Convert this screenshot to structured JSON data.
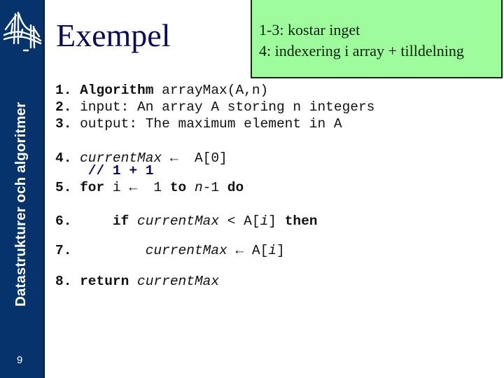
{
  "sidebar": {
    "vertical_title": "Datastrukturer och algoritmer",
    "logo_icon": "bridge-logo-icon",
    "page_number": "9"
  },
  "slide": {
    "title": "Exempel"
  },
  "note": {
    "line1": "1-3: kostar inget",
    "line2": "4: indexering i array + tilldelning"
  },
  "code": {
    "lines": [
      {
        "num": "1.",
        "parts": [
          "Algorithm",
          " arrayMax(A,n)"
        ]
      },
      {
        "num": "2.",
        "parts": [
          " input: An array A storing n integers"
        ]
      },
      {
        "num": "3.",
        "parts": [
          " output: The maximum element in A"
        ]
      },
      {
        "num": "4.",
        "parts": [
          " ",
          "currentMax",
          " ←  A[0]"
        ]
      },
      {
        "comment": "    // 1 + 1"
      },
      {
        "num": "5.",
        "parts": [
          " ",
          "for",
          " i ←  1 ",
          "to",
          " ",
          "n",
          "-1 ",
          "do"
        ]
      },
      {
        "num": "6.",
        "parts": [
          "     ",
          "if",
          " ",
          "currentMax",
          " < A[",
          "i",
          "] ",
          "then"
        ]
      },
      {
        "num": "7.",
        "parts": [
          "         ",
          "currentMax",
          " ← A[",
          "i",
          "]"
        ]
      },
      {
        "num": "8.",
        "parts": [
          " ",
          "return",
          " ",
          "currentMax"
        ]
      }
    ]
  },
  "colors": {
    "sidebar": "#06336b",
    "note_background": "#9efc9c",
    "title": "#0a0a5a"
  }
}
